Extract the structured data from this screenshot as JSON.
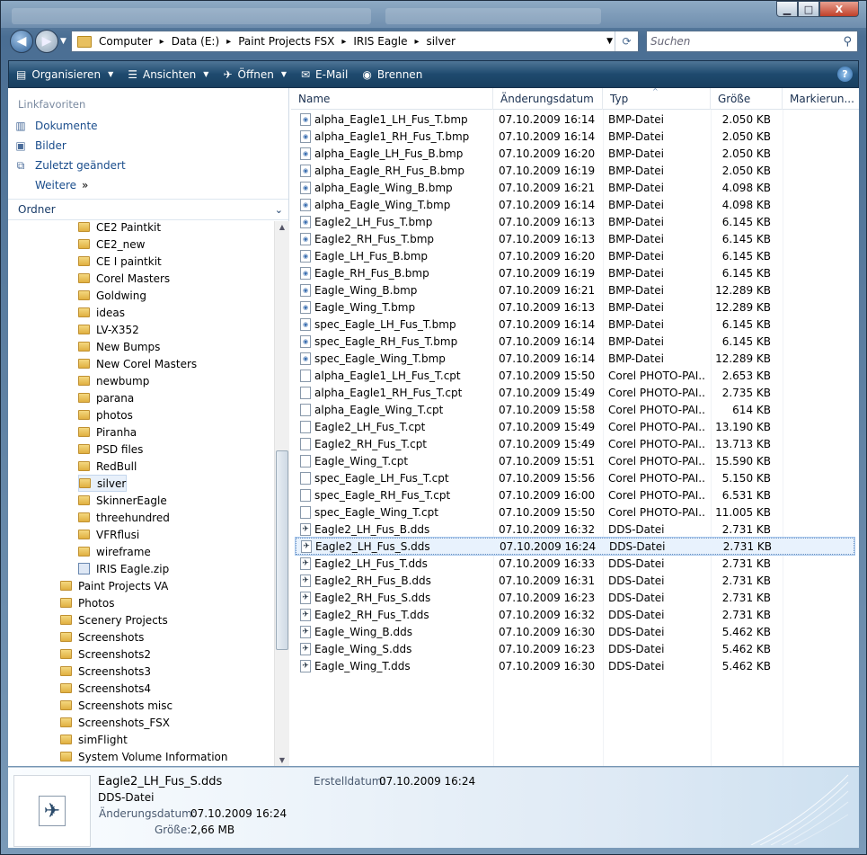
{
  "window": {
    "caption_buttons": {
      "minimize": "▁",
      "maximize": "□",
      "close": "X"
    }
  },
  "address": {
    "crumbs": [
      "Computer",
      "Data (E:)",
      "Paint Projects FSX",
      "IRIS Eagle",
      "silver"
    ],
    "search_placeholder": "Suchen"
  },
  "toolbar": {
    "organize": "Organisieren",
    "views": "Ansichten",
    "open": "Öffnen",
    "email": "E-Mail",
    "burn": "Brennen"
  },
  "nav": {
    "favorites_header": "Linkfavoriten",
    "links": [
      "Dokumente",
      "Bilder",
      "Zuletzt geändert",
      "Weitere"
    ],
    "folders_header": "Ordner",
    "tree": [
      {
        "label": "CE2 Paintkit",
        "level": 2
      },
      {
        "label": "CE2_new",
        "level": 2
      },
      {
        "label": "CE I paintkit",
        "level": 2
      },
      {
        "label": "Corel Masters",
        "level": 2
      },
      {
        "label": "Goldwing",
        "level": 2
      },
      {
        "label": "ideas",
        "level": 2
      },
      {
        "label": "LV-X352",
        "level": 2
      },
      {
        "label": "New Bumps",
        "level": 2
      },
      {
        "label": "New Corel Masters",
        "level": 2
      },
      {
        "label": "newbump",
        "level": 2
      },
      {
        "label": "parana",
        "level": 2
      },
      {
        "label": "photos",
        "level": 2
      },
      {
        "label": "Piranha",
        "level": 2
      },
      {
        "label": "PSD files",
        "level": 2
      },
      {
        "label": "RedBull",
        "level": 2
      },
      {
        "label": "silver",
        "level": 2,
        "selected": true
      },
      {
        "label": "SkinnerEagle",
        "level": 2
      },
      {
        "label": "threehundred",
        "level": 2
      },
      {
        "label": "VFRflusi",
        "level": 2
      },
      {
        "label": "wireframe",
        "level": 2
      },
      {
        "label": "IRIS Eagle.zip",
        "level": 2,
        "zip": true
      },
      {
        "label": "Paint Projects VA",
        "level": 1
      },
      {
        "label": "Photos",
        "level": 1
      },
      {
        "label": "Scenery Projects",
        "level": 1
      },
      {
        "label": "Screenshots",
        "level": 1
      },
      {
        "label": "Screenshots2",
        "level": 1
      },
      {
        "label": "Screenshots3",
        "level": 1
      },
      {
        "label": "Screenshots4",
        "level": 1
      },
      {
        "label": "Screenshots misc",
        "level": 1
      },
      {
        "label": "Screenshots_FSX",
        "level": 1
      },
      {
        "label": "simFlight",
        "level": 1
      },
      {
        "label": "System Volume Information",
        "level": 1
      }
    ]
  },
  "files": {
    "columns": [
      "Name",
      "Änderungsdatum",
      "Typ",
      "Größe",
      "Markierun..."
    ],
    "rows": [
      {
        "name": "alpha_Eagle1_LH_Fus_T.bmp",
        "date": "07.10.2009 16:14",
        "type": "BMP-Datei",
        "size": "2.050 KB",
        "kind": "bmp"
      },
      {
        "name": "alpha_Eagle1_RH_Fus_T.bmp",
        "date": "07.10.2009 16:14",
        "type": "BMP-Datei",
        "size": "2.050 KB",
        "kind": "bmp"
      },
      {
        "name": "alpha_Eagle_LH_Fus_B.bmp",
        "date": "07.10.2009 16:20",
        "type": "BMP-Datei",
        "size": "2.050 KB",
        "kind": "bmp"
      },
      {
        "name": "alpha_Eagle_RH_Fus_B.bmp",
        "date": "07.10.2009 16:19",
        "type": "BMP-Datei",
        "size": "2.050 KB",
        "kind": "bmp"
      },
      {
        "name": "alpha_Eagle_Wing_B.bmp",
        "date": "07.10.2009 16:21",
        "type": "BMP-Datei",
        "size": "4.098 KB",
        "kind": "bmp"
      },
      {
        "name": "alpha_Eagle_Wing_T.bmp",
        "date": "07.10.2009 16:14",
        "type": "BMP-Datei",
        "size": "4.098 KB",
        "kind": "bmp"
      },
      {
        "name": "Eagle2_LH_Fus_T.bmp",
        "date": "07.10.2009 16:13",
        "type": "BMP-Datei",
        "size": "6.145 KB",
        "kind": "bmp"
      },
      {
        "name": "Eagle2_RH_Fus_T.bmp",
        "date": "07.10.2009 16:13",
        "type": "BMP-Datei",
        "size": "6.145 KB",
        "kind": "bmp"
      },
      {
        "name": "Eagle_LH_Fus_B.bmp",
        "date": "07.10.2009 16:20",
        "type": "BMP-Datei",
        "size": "6.145 KB",
        "kind": "bmp"
      },
      {
        "name": "Eagle_RH_Fus_B.bmp",
        "date": "07.10.2009 16:19",
        "type": "BMP-Datei",
        "size": "6.145 KB",
        "kind": "bmp"
      },
      {
        "name": "Eagle_Wing_B.bmp",
        "date": "07.10.2009 16:21",
        "type": "BMP-Datei",
        "size": "12.289 KB",
        "kind": "bmp"
      },
      {
        "name": "Eagle_Wing_T.bmp",
        "date": "07.10.2009 16:13",
        "type": "BMP-Datei",
        "size": "12.289 KB",
        "kind": "bmp"
      },
      {
        "name": "spec_Eagle_LH_Fus_T.bmp",
        "date": "07.10.2009 16:14",
        "type": "BMP-Datei",
        "size": "6.145 KB",
        "kind": "bmp"
      },
      {
        "name": "spec_Eagle_RH_Fus_T.bmp",
        "date": "07.10.2009 16:14",
        "type": "BMP-Datei",
        "size": "6.145 KB",
        "kind": "bmp"
      },
      {
        "name": "spec_Eagle_Wing_T.bmp",
        "date": "07.10.2009 16:14",
        "type": "BMP-Datei",
        "size": "12.289 KB",
        "kind": "bmp"
      },
      {
        "name": "alpha_Eagle1_LH_Fus_T.cpt",
        "date": "07.10.2009 15:50",
        "type": "Corel PHOTO-PAI...",
        "size": "2.653 KB",
        "kind": "cpt"
      },
      {
        "name": "alpha_Eagle1_RH_Fus_T.cpt",
        "date": "07.10.2009 15:49",
        "type": "Corel PHOTO-PAI...",
        "size": "2.735 KB",
        "kind": "cpt"
      },
      {
        "name": "alpha_Eagle_Wing_T.cpt",
        "date": "07.10.2009 15:58",
        "type": "Corel PHOTO-PAI...",
        "size": "614 KB",
        "kind": "cpt"
      },
      {
        "name": "Eagle2_LH_Fus_T.cpt",
        "date": "07.10.2009 15:49",
        "type": "Corel PHOTO-PAI...",
        "size": "13.190 KB",
        "kind": "cpt"
      },
      {
        "name": "Eagle2_RH_Fus_T.cpt",
        "date": "07.10.2009 15:49",
        "type": "Corel PHOTO-PAI...",
        "size": "13.713 KB",
        "kind": "cpt"
      },
      {
        "name": "Eagle_Wing_T.cpt",
        "date": "07.10.2009 15:51",
        "type": "Corel PHOTO-PAI...",
        "size": "15.590 KB",
        "kind": "cpt"
      },
      {
        "name": "spec_Eagle_LH_Fus_T.cpt",
        "date": "07.10.2009 15:56",
        "type": "Corel PHOTO-PAI...",
        "size": "5.150 KB",
        "kind": "cpt"
      },
      {
        "name": "spec_Eagle_RH_Fus_T.cpt",
        "date": "07.10.2009 16:00",
        "type": "Corel PHOTO-PAI...",
        "size": "6.531 KB",
        "kind": "cpt"
      },
      {
        "name": "spec_Eagle_Wing_T.cpt",
        "date": "07.10.2009 15:50",
        "type": "Corel PHOTO-PAI...",
        "size": "11.005 KB",
        "kind": "cpt"
      },
      {
        "name": "Eagle2_LH_Fus_B.dds",
        "date": "07.10.2009 16:32",
        "type": "DDS-Datei",
        "size": "2.731 KB",
        "kind": "dds"
      },
      {
        "name": "Eagle2_LH_Fus_S.dds",
        "date": "07.10.2009 16:24",
        "type": "DDS-Datei",
        "size": "2.731 KB",
        "kind": "dds",
        "selected": true
      },
      {
        "name": "Eagle2_LH_Fus_T.dds",
        "date": "07.10.2009 16:33",
        "type": "DDS-Datei",
        "size": "2.731 KB",
        "kind": "dds"
      },
      {
        "name": "Eagle2_RH_Fus_B.dds",
        "date": "07.10.2009 16:31",
        "type": "DDS-Datei",
        "size": "2.731 KB",
        "kind": "dds"
      },
      {
        "name": "Eagle2_RH_Fus_S.dds",
        "date": "07.10.2009 16:23",
        "type": "DDS-Datei",
        "size": "2.731 KB",
        "kind": "dds"
      },
      {
        "name": "Eagle2_RH_Fus_T.dds",
        "date": "07.10.2009 16:32",
        "type": "DDS-Datei",
        "size": "2.731 KB",
        "kind": "dds"
      },
      {
        "name": "Eagle_Wing_B.dds",
        "date": "07.10.2009 16:30",
        "type": "DDS-Datei",
        "size": "5.462 KB",
        "kind": "dds"
      },
      {
        "name": "Eagle_Wing_S.dds",
        "date": "07.10.2009 16:23",
        "type": "DDS-Datei",
        "size": "5.462 KB",
        "kind": "dds"
      },
      {
        "name": "Eagle_Wing_T.dds",
        "date": "07.10.2009 16:30",
        "type": "DDS-Datei",
        "size": "5.462 KB",
        "kind": "dds"
      }
    ]
  },
  "details": {
    "filename": "Eagle2_LH_Fus_S.dds",
    "filetype": "DDS-Datei",
    "modified_label": "Änderungsdatum:",
    "modified_value": "07.10.2009 16:24",
    "size_label": "Größe:",
    "size_value": "2,66 MB",
    "created_label": "Erstelldatum:",
    "created_value": "07.10.2009 16:24"
  }
}
